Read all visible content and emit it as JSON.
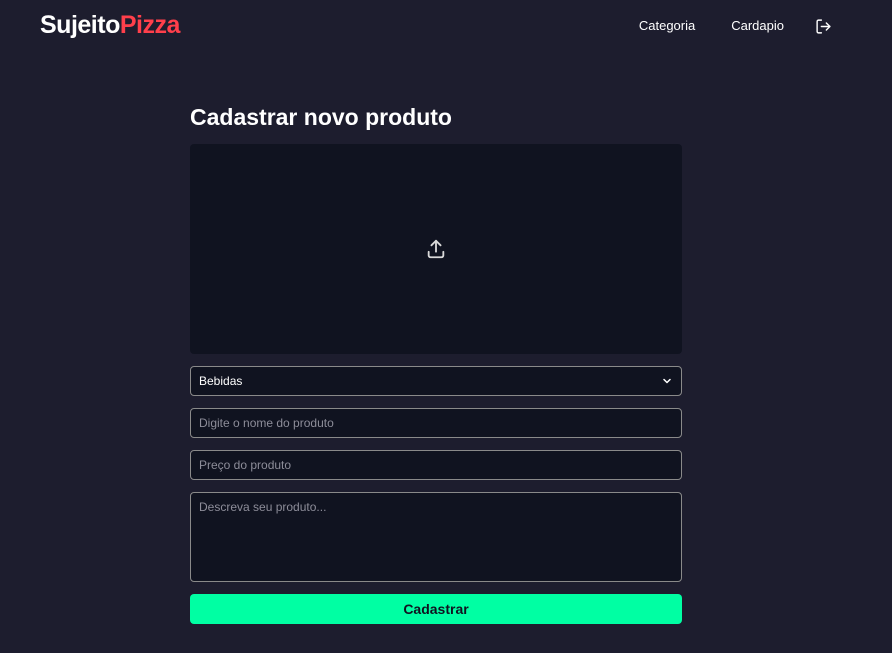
{
  "header": {
    "brand_part1": "Sujeito",
    "brand_part2": "Pizza",
    "nav": [
      {
        "label": "Categoria"
      },
      {
        "label": "Cardapio"
      }
    ],
    "logout_icon": "logout-icon"
  },
  "main": {
    "title": "Cadastrar novo produto",
    "upload_icon": "upload-icon",
    "category_select": {
      "selected": "Bebidas"
    },
    "name_input": {
      "value": "",
      "placeholder": "Digite o nome do produto"
    },
    "price_input": {
      "value": "",
      "placeholder": "Preço do produto"
    },
    "description_input": {
      "value": "",
      "placeholder": "Descreva seu produto..."
    },
    "submit_label": "Cadastrar"
  },
  "colors": {
    "background": "#1d1d2e",
    "surface": "#101320",
    "brand_accent": "#ff3f4b",
    "button": "#00ffa3",
    "border": "#8a8a8a"
  }
}
